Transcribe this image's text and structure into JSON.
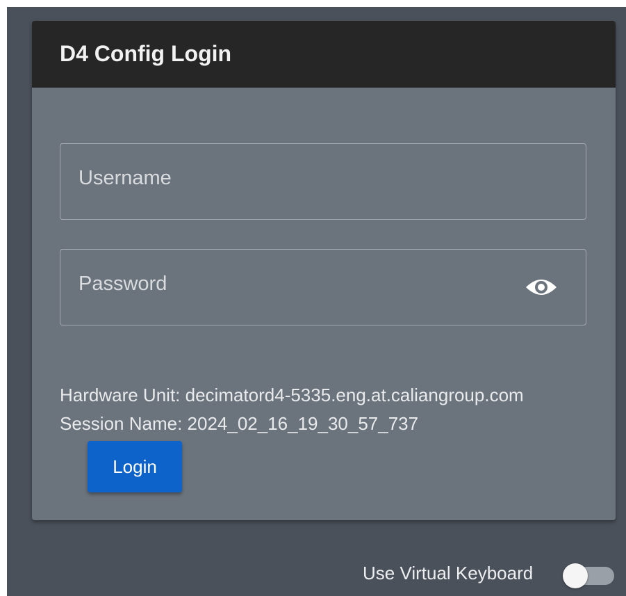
{
  "login_card": {
    "title": "D4 Config Login",
    "username": {
      "placeholder": "Username",
      "value": ""
    },
    "password": {
      "placeholder": "Password",
      "value": "",
      "visibility_icon": "eye-icon"
    },
    "hardware_unit": "Hardware Unit: decimatord4-5335.eng.at.caliangroup.com",
    "session_name": "Session Name: 2024_02_16_19_30_57_737",
    "login_label": "Login"
  },
  "footer": {
    "virtual_keyboard_label": "Use Virtual Keyboard",
    "virtual_keyboard_enabled": false
  },
  "colors": {
    "background": "#4b515b",
    "card": "#6b737d",
    "header": "#262626",
    "primary_button": "#0d63c9"
  }
}
